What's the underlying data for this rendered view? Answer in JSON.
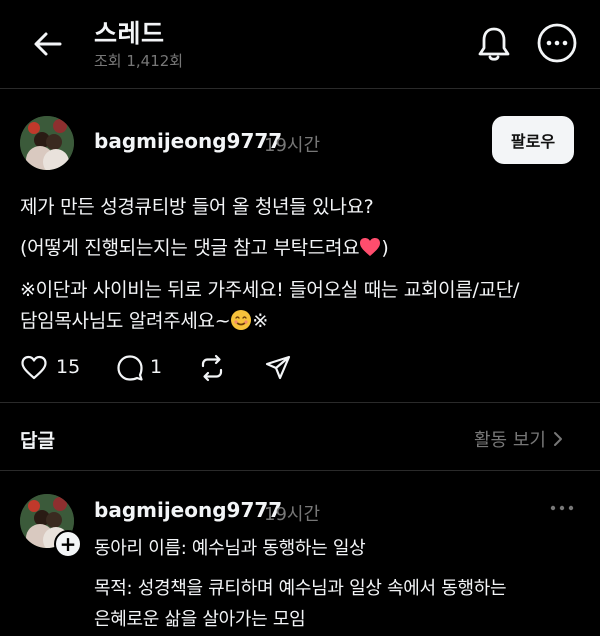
{
  "header": {
    "title": "스레드",
    "views": "조회 1,412회"
  },
  "post": {
    "username": "bagmijeong9777",
    "time": "19시간",
    "follow_label": "팔로우",
    "lines": [
      "제가 만든 성경큐티방 들어 올 청년들 있나요?",
      "(어떻게 진행되는지는 댓글 참고 부탁드려요",
      "※이단과 사이비는 뒤로 가주세요!  들어오실 때는 교회이름/교단/",
      "담임목사님도 알려주세요~",
      "※"
    ],
    "likes": "15",
    "replies": "1"
  },
  "replies_section": {
    "label": "답글",
    "activity_label": "활동 보기"
  },
  "reply": {
    "username": "bagmijeong9777",
    "time": "19시간",
    "lines": [
      "동아리 이름: 예수님과 동행하는 일상",
      "목적: 성경책을 큐티하며 예수님과 일상 속에서 동행하는",
      "은혜로운 삶을 살아가는 모임"
    ]
  },
  "colors": {
    "background": "#000000",
    "text": "#f3f5f7",
    "muted": "#777777",
    "heart_emoji": "#ff4d6d"
  }
}
